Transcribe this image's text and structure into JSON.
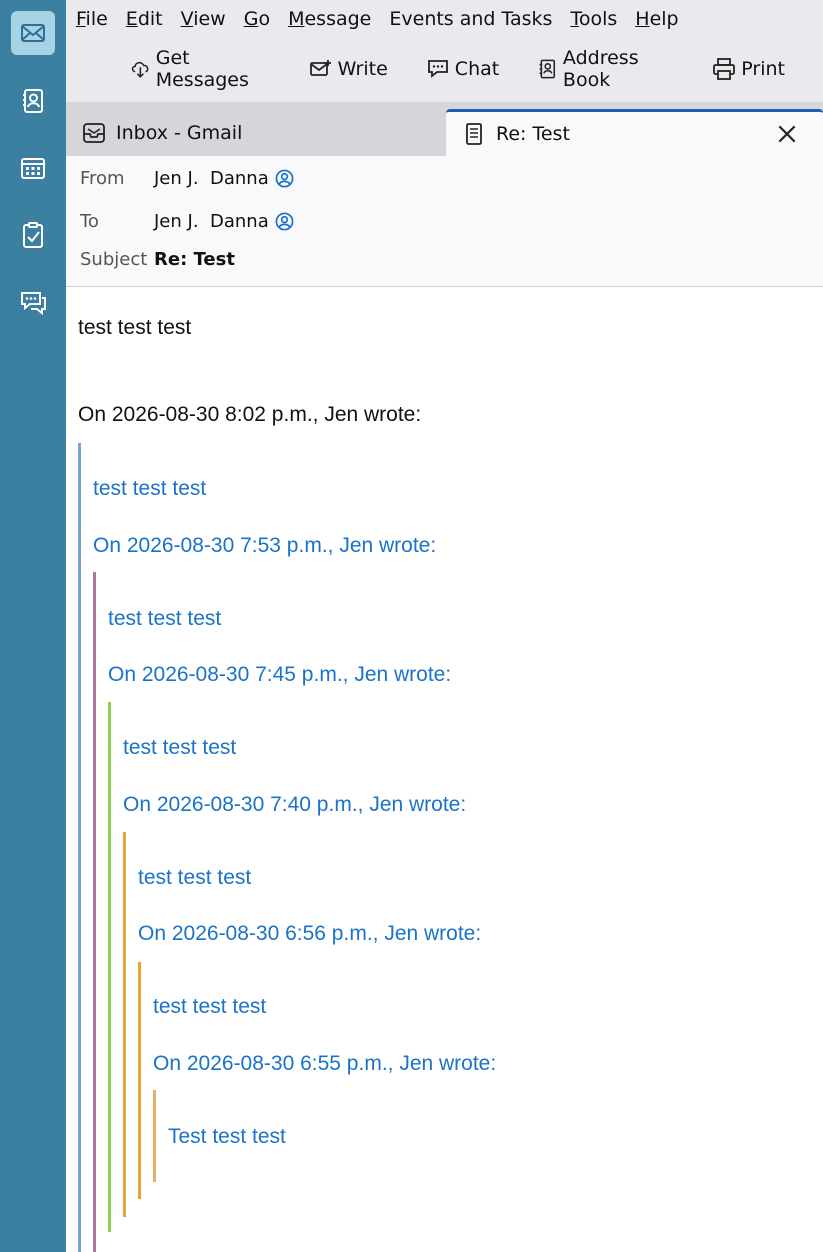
{
  "menubar": {
    "items": [
      {
        "label": "File",
        "accel": "F",
        "rest": "ile"
      },
      {
        "label": "Edit",
        "accel": "E",
        "rest": "dit"
      },
      {
        "label": "View",
        "accel": "V",
        "rest": "iew"
      },
      {
        "label": "Go",
        "accel": "G",
        "rest": "o"
      },
      {
        "label": "Message",
        "accel": "M",
        "rest": "essage"
      },
      {
        "label": "Events and Tasks",
        "accel": "",
        "rest": "Events and Tasks"
      },
      {
        "label": "Tools",
        "accel": "T",
        "rest": "ools"
      },
      {
        "label": "Help",
        "accel": "H",
        "rest": "elp"
      }
    ]
  },
  "toolbar": {
    "get_messages": "Get Messages",
    "write": "Write",
    "chat": "Chat",
    "address_book": "Address Book",
    "print": "Print"
  },
  "tabs": {
    "inbox": "Inbox - Gmail",
    "active": "Re: Test"
  },
  "header": {
    "from_label": "From",
    "from_value": "Jen J.  Danna",
    "to_label": "To",
    "to_value": "Jen J.  Danna",
    "subject_label": "Subject",
    "subject_value": "Re: Test"
  },
  "body": {
    "reply": "test test test",
    "attribution": "On 2026-08-30 8:02 p.m., Jen wrote:",
    "quotes": [
      {
        "text": "test test test",
        "attribution": "On 2026-08-30 7:53 p.m., Jen wrote:"
      },
      {
        "text": "test test test",
        "attribution": "On 2026-08-30 7:45 p.m., Jen wrote:"
      },
      {
        "text": "test test test",
        "attribution": "On 2026-08-30 7:40 p.m., Jen wrote:"
      },
      {
        "text": "test test test",
        "attribution": "On 2026-08-30 6:56 p.m., Jen wrote:"
      },
      {
        "text": "test test test",
        "attribution": "On 2026-08-30 6:55 p.m., Jen wrote:"
      },
      {
        "text": "Test test test"
      }
    ]
  },
  "colors": {
    "spaces_bar": "#3b7fa1",
    "active_space": "#a8d3e6",
    "quote_text": "#1b73c8",
    "quote_bars": [
      "#7aa3c9",
      "#a779a0",
      "#8ed14e",
      "#e6a535",
      "#e6a535",
      "#e6b060"
    ]
  }
}
